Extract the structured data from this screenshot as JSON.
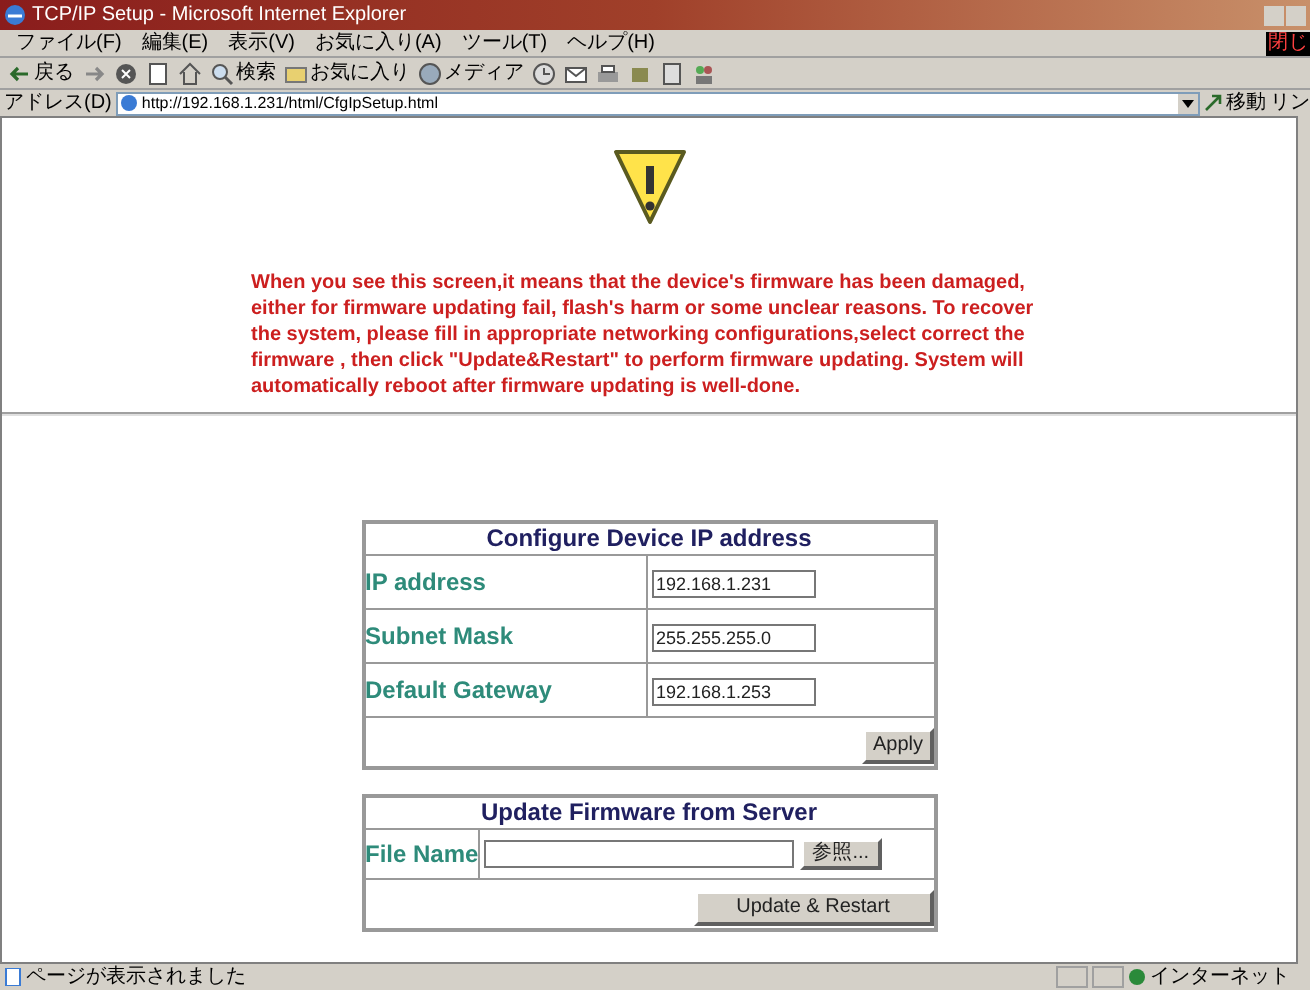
{
  "window": {
    "title": "TCP/IP Setup - Microsoft Internet Explorer",
    "close_label": "閉じ"
  },
  "menu": [
    "ファイル(F)",
    "編集(E)",
    "表示(V)",
    "お気に入り(A)",
    "ツール(T)",
    "ヘルプ(H)"
  ],
  "toolbar": [
    {
      "kind": "back",
      "label": "戻る"
    },
    {
      "kind": "forward"
    },
    {
      "kind": "stop"
    },
    {
      "kind": "refresh"
    },
    {
      "kind": "home"
    },
    {
      "kind": "search",
      "label": "検索"
    },
    {
      "kind": "favorites",
      "label": "お気に入り"
    },
    {
      "kind": "media",
      "label": "メディア"
    },
    {
      "kind": "history"
    },
    {
      "kind": "mail"
    },
    {
      "kind": "print"
    },
    {
      "kind": "edit"
    },
    {
      "kind": "discuss"
    },
    {
      "kind": "messenger"
    }
  ],
  "address_bar": {
    "label": "アドレス(D)",
    "url": "http://192.168.1.231/html/CfgIpSetup.html",
    "go": "移動",
    "links": "リン"
  },
  "warning": "When you see this screen,it means that the device's firmware has been damaged, either for firmware updating fail, flash's harm or some unclear reasons. To recover the system, please fill in appropriate networking configurations,select correct the firmware , then click \"Update&Restart\" to perform firmware updating. System will automatically reboot after firmware updating is well-done.",
  "ip_form": {
    "title": "Configure Device IP address",
    "fields": [
      {
        "label": "IP address",
        "value": "192.168.1.231"
      },
      {
        "label": "Subnet Mask",
        "value": "255.255.255.0"
      },
      {
        "label": "Default Gateway",
        "value": "192.168.1.253"
      }
    ],
    "button": "Apply"
  },
  "firmware_form": {
    "title": "Update Firmware from Server",
    "label": "File Name",
    "browse": "参照...",
    "button": "Update & Restart"
  },
  "status_bar": {
    "text": "ページが表示されました",
    "zone": "インターネット"
  }
}
